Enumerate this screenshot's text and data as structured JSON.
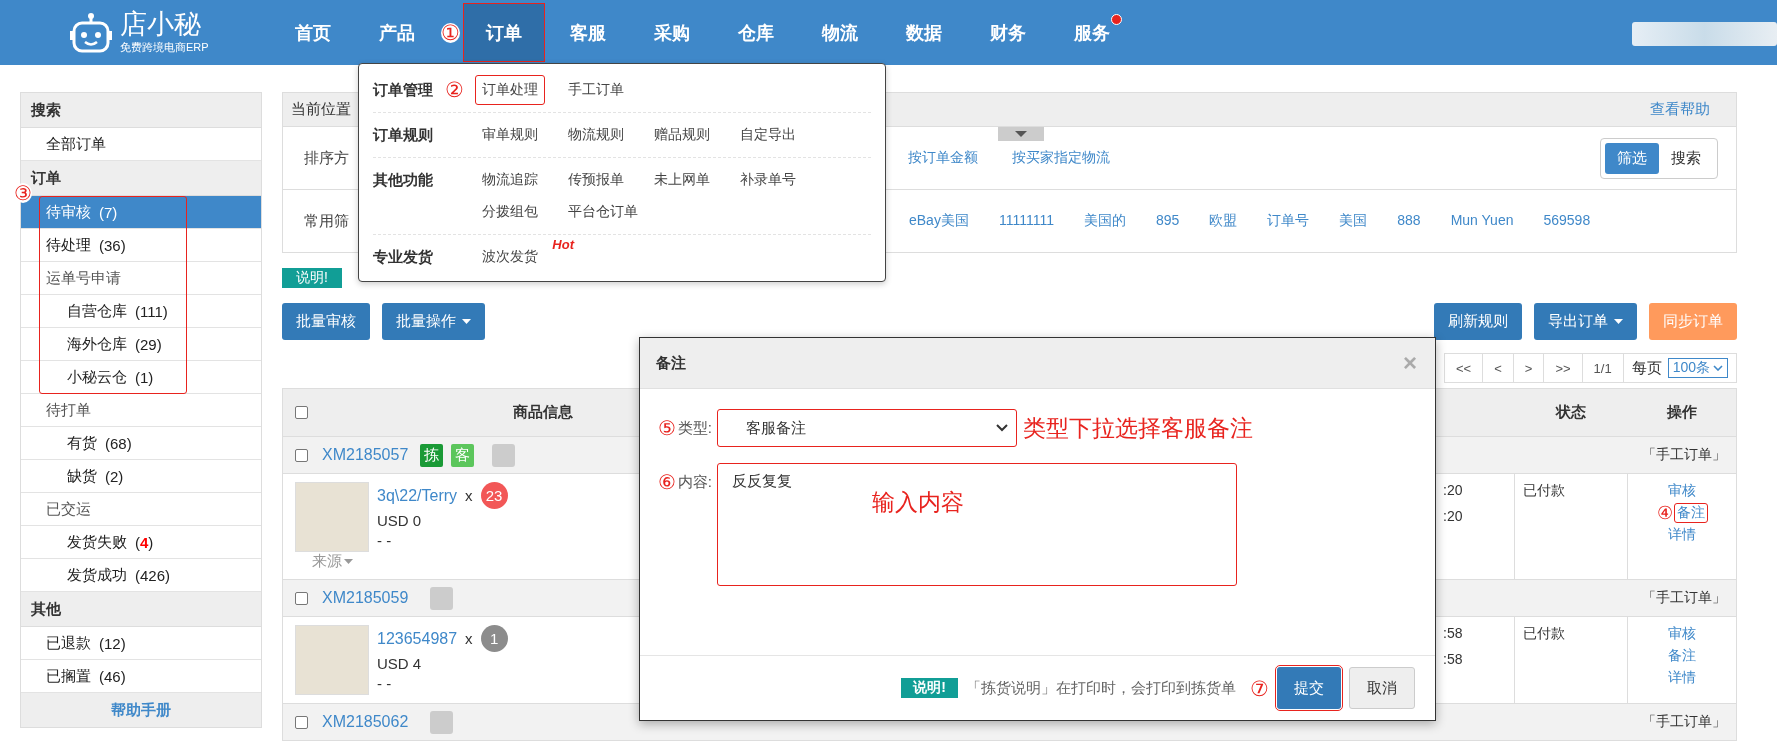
{
  "header": {
    "logo_text": "店小秘",
    "logo_subtitle": "免费跨境电商ERP",
    "nav": [
      {
        "label": "首页",
        "selected": false,
        "marked": false,
        "notify": false
      },
      {
        "label": "产品",
        "selected": false,
        "marked": false,
        "notify": false
      },
      {
        "label": "订单",
        "selected": true,
        "marked": true,
        "notify": false,
        "annotation": "①"
      },
      {
        "label": "客服",
        "selected": false,
        "marked": false,
        "notify": false
      },
      {
        "label": "采购",
        "selected": false,
        "marked": false,
        "notify": false
      },
      {
        "label": "仓库",
        "selected": false,
        "marked": false,
        "notify": false
      },
      {
        "label": "物流",
        "selected": false,
        "marked": false,
        "notify": false
      },
      {
        "label": "数据",
        "selected": false,
        "marked": false,
        "notify": false
      },
      {
        "label": "财务",
        "selected": false,
        "marked": false,
        "notify": false
      },
      {
        "label": "服务",
        "selected": false,
        "marked": false,
        "notify": true
      }
    ]
  },
  "sidebar": {
    "sections": [
      {
        "title": "搜索",
        "items": [
          {
            "label": "全部订单",
            "selected": false,
            "marked": false
          }
        ]
      },
      {
        "title": "订单",
        "annotation": "③",
        "items": [
          {
            "label": "待审核",
            "count": "(7)",
            "selected": true,
            "marked": true
          },
          {
            "label": "待处理",
            "count": "(36)",
            "selected": false,
            "marked": true
          },
          {
            "label": "运单号申请",
            "selected": false,
            "marked": true,
            "children": [
              {
                "label": "自营仓库",
                "count": "(111)",
                "selected": false
              },
              {
                "label": "海外仓库",
                "count": "(29)",
                "selected": false
              },
              {
                "label": "小秘云仓",
                "count": "(1)",
                "selected": false
              }
            ]
          },
          {
            "label": "待打单",
            "selected": false,
            "marked": false,
            "children": [
              {
                "label": "有货",
                "count": "(68)",
                "selected": false
              },
              {
                "label": "缺货",
                "count": "(2)",
                "selected": false
              }
            ]
          },
          {
            "label": "已交运",
            "selected": false,
            "marked": false,
            "children": [
              {
                "label": "发货失败",
                "count": "(**4**)",
                "alert": true,
                "selected": false
              },
              {
                "label": "发货成功",
                "count": "(426)",
                "selected": false
              }
            ]
          }
        ]
      },
      {
        "title": "其他",
        "items": [
          {
            "label": "已退款",
            "count": "(12)",
            "selected": false,
            "marked": false
          },
          {
            "label": "已搁置",
            "count": "(46)",
            "selected": false,
            "marked": false
          }
        ]
      }
    ],
    "help": "帮助手册"
  },
  "breadcrumb": {
    "label": "当前位置",
    "help": "查看帮助"
  },
  "sort": {
    "label": "排序方",
    "options": [
      "按订单金额",
      "按买家指定物流"
    ],
    "mode_toggle": [
      {
        "label": "筛选",
        "selected": true
      },
      {
        "label": "搜索",
        "selected": false
      }
    ]
  },
  "filters": {
    "label": "常用筛",
    "items": [
      "eBay美国",
      "11111111",
      "美国的",
      "895",
      "欧盟",
      "订单号",
      "美国",
      "888",
      "Mun Yuen",
      "569598"
    ]
  },
  "notice_badge": "说明!",
  "actions_left": [
    {
      "label": "批量审核",
      "kind": "primary",
      "dropdown": false
    },
    {
      "label": "批量操作",
      "kind": "primary",
      "dropdown": true
    }
  ],
  "actions_right": [
    {
      "label": "刷新规则",
      "kind": "primary",
      "dropdown": false
    },
    {
      "label": "导出订单",
      "kind": "primary",
      "dropdown": true
    },
    {
      "label": "同步订单",
      "kind": "warning",
      "dropdown": false
    }
  ],
  "pagination": {
    "pages": [
      "<<",
      "<",
      ">",
      ">>",
      "1/1"
    ],
    "per_page_label": "每页",
    "per_page": "100条"
  },
  "table": {
    "columns": [
      "商品信息",
      "状态",
      "操作"
    ],
    "all_checked": false,
    "orders": [
      {
        "order_no": "XM2185057",
        "checked": false,
        "tags": [
          {
            "label": "拣",
            "color": "#1a9a36"
          },
          {
            "label": "客",
            "color": "#5cc65c"
          }
        ],
        "source_type": "「手工订单」",
        "item": {
          "product": "3q\\22/Terry",
          "times_x": "x",
          "qty": "23",
          "color": "#f25757",
          "price": "USD 0",
          "sku": "- -",
          "source_label": "来源",
          "times": [
            ":20",
            ":20"
          ],
          "status": "已付款",
          "ops": [
            {
              "label": "审核",
              "marked": false
            },
            {
              "label": "备注",
              "marked": true,
              "annotation": "④"
            },
            {
              "label": "详情",
              "marked": false
            }
          ]
        }
      },
      {
        "order_no": "XM2185059",
        "checked": false,
        "source_type": "「手工订单」",
        "item": {
          "product": "123654987",
          "times_x": "x",
          "qty": "1",
          "color": "#8c8c8c",
          "price": "USD 4",
          "sku": "- -",
          "times": [
            ":58",
            ":58"
          ],
          "status": "已付款",
          "ops": [
            {
              "label": "审核",
              "marked": false
            },
            {
              "label": "备注",
              "marked": false
            },
            {
              "label": "详情",
              "marked": false
            }
          ]
        }
      },
      {
        "order_no": "XM2185062",
        "checked": false,
        "source_type": "「手工订单」"
      }
    ]
  },
  "menu": {
    "groups": [
      {
        "title": "订单管理",
        "annotation": "②",
        "items": [
          {
            "label": "订单处理",
            "marked": true
          },
          {
            "label": "手工订单",
            "marked": false
          }
        ]
      },
      {
        "title": "订单规则",
        "items": [
          {
            "label": "审单规则",
            "marked": false
          },
          {
            "label": "物流规则",
            "marked": false
          },
          {
            "label": "赠品规则",
            "marked": false
          },
          {
            "label": "自定导出",
            "marked": false
          }
        ]
      },
      {
        "title": "其他功能",
        "items": [
          {
            "label": "物流追踪",
            "marked": false
          },
          {
            "label": "传预报单",
            "marked": false
          },
          {
            "label": "未上网单",
            "marked": false
          },
          {
            "label": "补录单号",
            "marked": false
          },
          {
            "label": "分拨组包",
            "marked": false
          },
          {
            "label": "平台仓订单",
            "marked": false
          }
        ]
      },
      {
        "title": "专业发货",
        "items": [
          {
            "label": "波次发货",
            "marked": false,
            "badge": "Hot"
          }
        ]
      }
    ]
  },
  "dialog": {
    "title": "备注",
    "close": "×",
    "fields": [
      {
        "kind": "select",
        "annotation": "⑤",
        "label": "类型:",
        "value": "客服备注",
        "marked": true,
        "note": "类型下拉选择客服备注"
      },
      {
        "kind": "textarea",
        "annotation": "⑥",
        "label": "内容:",
        "value": "反反复复",
        "marked": true,
        "note": "输入内容"
      }
    ],
    "notice_badge": "说明!",
    "notice": "「拣货说明」在打印时，会打印到拣货单",
    "buttons": [
      {
        "label": "提交",
        "kind": "primary",
        "marked": true,
        "annotation": "⑦"
      },
      {
        "label": "取消",
        "kind": "default",
        "marked": false
      }
    ]
  }
}
